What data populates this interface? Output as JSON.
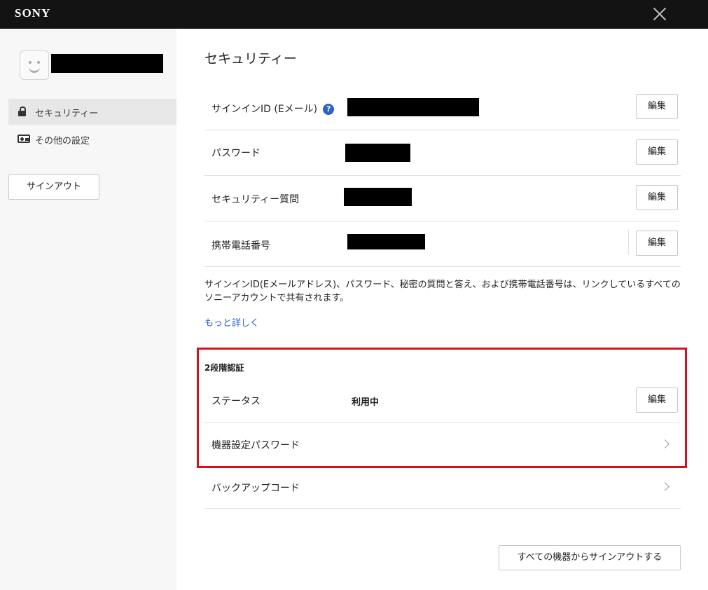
{
  "header": {
    "logo": "SONY"
  },
  "sidebar": {
    "items": [
      {
        "label": "セキュリティー",
        "icon": "lock-icon"
      },
      {
        "label": "その他の設定",
        "icon": "id-card-icon"
      }
    ],
    "signout_label": "サインアウト"
  },
  "main": {
    "title": "セキュリティー",
    "rows": [
      {
        "label": "サインインID (Eメール)",
        "help": "?",
        "edit": "編集"
      },
      {
        "label": "パスワード",
        "edit": "編集"
      },
      {
        "label": "セキュリティー質問",
        "edit": "編集"
      },
      {
        "label": "携帯電話番号",
        "edit": "編集"
      }
    ],
    "note": "サインインID(Eメールアドレス)、パスワード、秘密の質問と答え、および携帯電話番号は、リンクしているすべてのソニーアカウントで共有されます。",
    "more_link": "もっと詳しく",
    "two_step": {
      "title": "2段階認証",
      "status_label": "ステータス",
      "status_value": "利用中",
      "edit": "編集",
      "device_password": "機器設定パスワード"
    },
    "backup_code": "バックアップコード",
    "signout_all": "すべての機器からサインアウトする"
  },
  "colors": {
    "accent": "#2e62c9",
    "highlight": "#d4121e",
    "topbar": "#131313"
  }
}
